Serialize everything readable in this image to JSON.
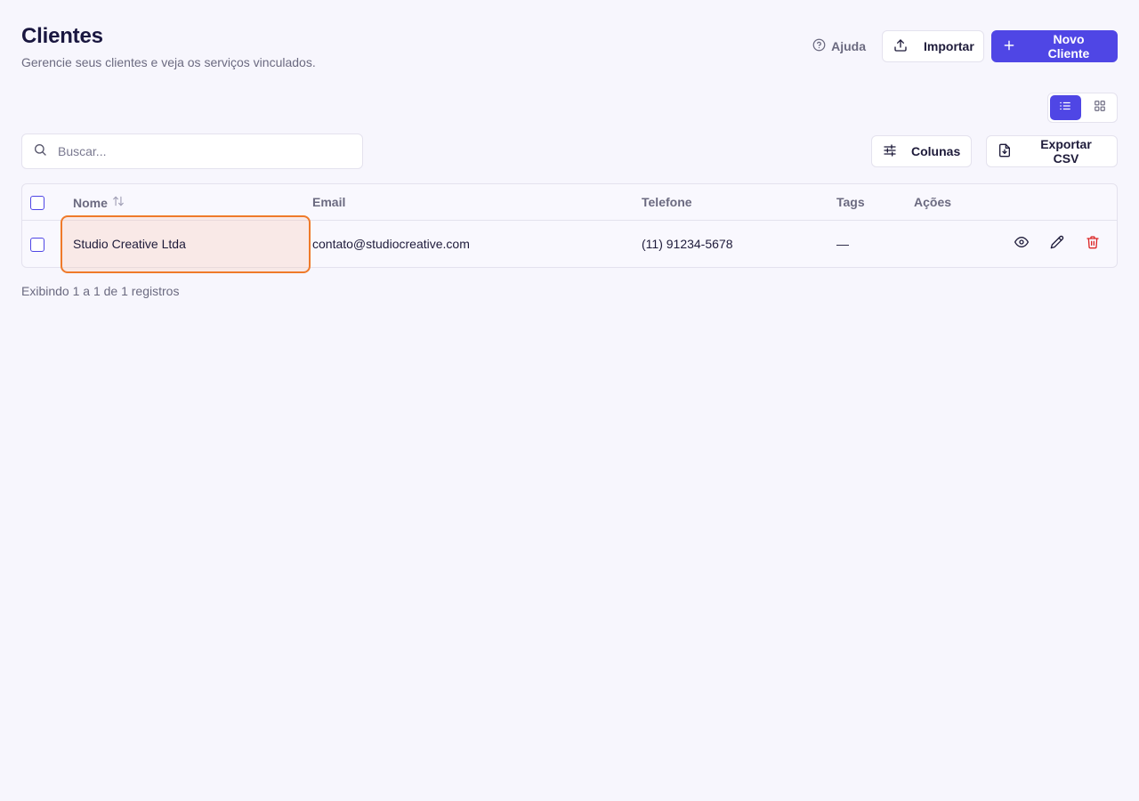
{
  "header": {
    "title": "Clientes",
    "subtitle": "Gerencie seus clientes e veja os serviços vinculados.",
    "help_label": "Ajuda",
    "import_label": "Importar",
    "new_client_label": "Novo Cliente"
  },
  "view_toggle": {
    "active": "list"
  },
  "search": {
    "placeholder": "Buscar...",
    "value": ""
  },
  "toolbar": {
    "columns_label": "Colunas",
    "export_label": "Exportar CSV"
  },
  "table": {
    "columns": {
      "name": "Nome",
      "email": "Email",
      "phone": "Telefone",
      "tags": "Tags",
      "actions": "Ações"
    },
    "rows": [
      {
        "name": "Studio Creative Ltda",
        "email": "contato@studiocreative.com",
        "phone": "(11) 91234-5678",
        "tags": "—"
      }
    ]
  },
  "footer": {
    "summary": "Exibindo 1 a 1 de 1 registros"
  },
  "colors": {
    "primary": "#4f46e5",
    "highlight": "#ef7a2a",
    "danger": "#dc2626",
    "background": "#f7f6fd"
  }
}
